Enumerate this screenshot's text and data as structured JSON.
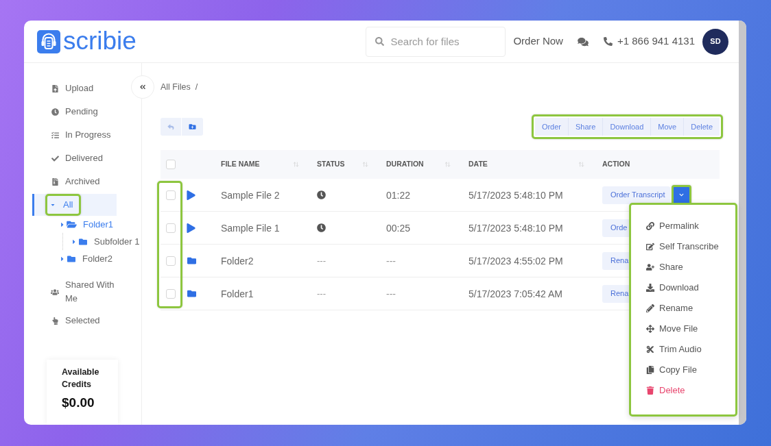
{
  "logo": {
    "text": "scribie"
  },
  "header": {
    "search": {
      "placeholder": "Search for files"
    },
    "order_link": "Order Now",
    "phone": "+1 866 941 4131",
    "avatar": "SD"
  },
  "sidebar": {
    "items": [
      {
        "label": "Upload",
        "selected": false
      },
      {
        "label": "Pending",
        "selected": false
      },
      {
        "label": "In Progress",
        "selected": false
      },
      {
        "label": "Delivered",
        "selected": false
      },
      {
        "label": "Archived",
        "selected": false
      },
      {
        "label": "All",
        "selected": true,
        "expanded": true,
        "highlighted": true,
        "children": [
          {
            "label": "Folder1",
            "expanded": true,
            "children": [
              {
                "label": "Subfolder 1",
                "expanded": false
              }
            ]
          },
          {
            "label": "Folder2",
            "expanded": false
          }
        ]
      },
      {
        "label": "Shared With Me",
        "selected": false
      },
      {
        "label": "Selected",
        "selected": false
      }
    ],
    "credits": {
      "label": "Available Credits",
      "amount": "$0.00"
    }
  },
  "breadcrumb": {
    "items": [
      "All Files"
    ],
    "separator": "/"
  },
  "bulk_actions": {
    "highlighted": true,
    "buttons": [
      "Order",
      "Share",
      "Download",
      "Move",
      "Delete"
    ]
  },
  "table": {
    "select_all": {
      "checked": false
    },
    "checkboxes_highlighted": true,
    "columns": [
      {
        "label": "FILE NAME",
        "sortable": true
      },
      {
        "label": "STATUS",
        "sortable": true
      },
      {
        "label": "DURATION",
        "sortable": true
      },
      {
        "label": "DATE",
        "sortable": true
      },
      {
        "label": "ACTION",
        "sortable": false
      }
    ],
    "rows": [
      {
        "kind": "file",
        "checked": false,
        "name": "Sample File 2",
        "status": {
          "kind": "icon"
        },
        "duration": "01:22",
        "date": "5/17/2023 5:48:10 PM",
        "action": {
          "label": "Order Transcript",
          "toggle": {
            "expanded": true,
            "highlighted": true
          },
          "menu": {
            "highlighted": true,
            "items": [
              {
                "label": "Permalink",
                "kind": "default"
              },
              {
                "label": "Self Transcribe",
                "kind": "default"
              },
              {
                "label": "Share",
                "kind": "default"
              },
              {
                "label": "Download",
                "kind": "default"
              },
              {
                "label": "Rename",
                "kind": "default"
              },
              {
                "label": "Move File",
                "kind": "default"
              },
              {
                "label": "Trim Audio",
                "kind": "default"
              },
              {
                "label": "Copy File",
                "kind": "default"
              },
              {
                "label": "Delete",
                "kind": "danger"
              }
            ]
          }
        }
      },
      {
        "kind": "file",
        "checked": false,
        "name": "Sample File 1",
        "status": {
          "kind": "icon"
        },
        "duration": "00:25",
        "date": "5/17/2023 5:48:10 PM",
        "action": {
          "label": "Orde"
        }
      },
      {
        "kind": "folder",
        "checked": false,
        "name": "Folder2",
        "status": {
          "kind": "text",
          "text": "---"
        },
        "duration": "---",
        "date": "5/17/2023 4:55:02 PM",
        "action": {
          "label": "Rena"
        }
      },
      {
        "kind": "folder",
        "checked": false,
        "name": "Folder1",
        "status": {
          "kind": "text",
          "text": "---"
        },
        "duration": "---",
        "date": "5/17/2023 7:05:42 AM",
        "action": {
          "label": "Rena"
        }
      }
    ]
  }
}
